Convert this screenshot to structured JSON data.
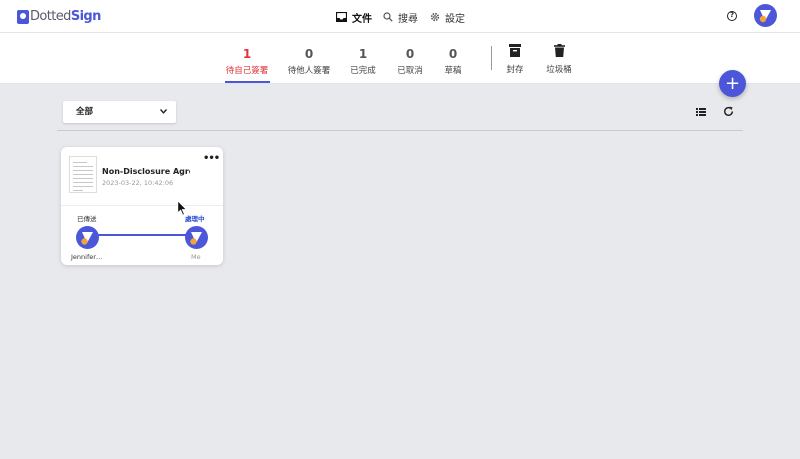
{
  "app": {
    "logo_prefix": "Dotted",
    "logo_suffix": "Sign"
  },
  "nav": {
    "documents_label": "文件",
    "search_label": "搜尋",
    "settings_label": "設定"
  },
  "tabs": [
    {
      "count": "1",
      "label": "待自己簽署",
      "active": true
    },
    {
      "count": "0",
      "label": "待他人簽署"
    },
    {
      "count": "1",
      "label": "已完成"
    },
    {
      "count": "0",
      "label": "已取消"
    },
    {
      "count": "0",
      "label": "草稿"
    }
  ],
  "archive_label": "封存",
  "trash_label": "垃圾桶",
  "fab_label": "+",
  "filter": {
    "selected": "全部"
  },
  "card": {
    "title": "Non-Disclosure Agre…",
    "date": "2023-03-22, 10:42:06",
    "more": "•••",
    "status_sent": "已傳送",
    "status_processing": "處理中",
    "signer1": "Jennifer…",
    "signer2": "Me"
  },
  "colors": {
    "accent": "#4b57d8",
    "active_tab": "#e0353c",
    "processing": "#2f4fd8",
    "avatar_dot": "#f2a33a"
  }
}
